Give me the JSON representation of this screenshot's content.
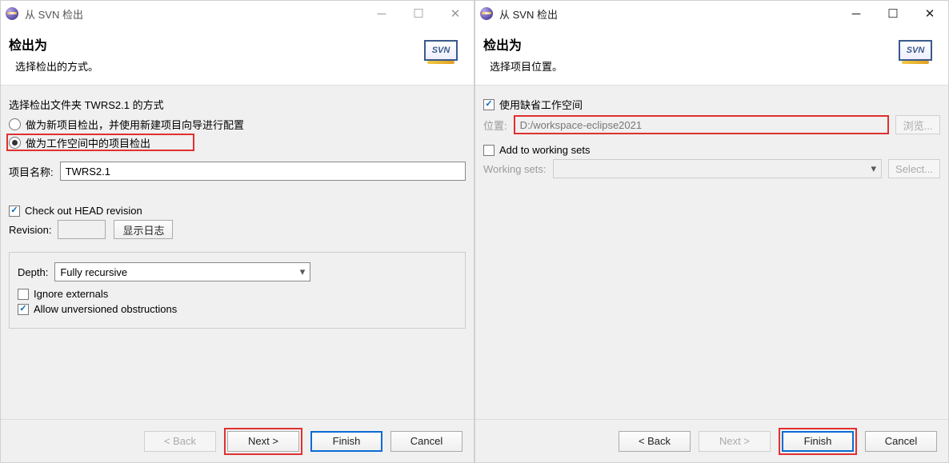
{
  "left": {
    "title": "从 SVN 检出",
    "header_title": "检出为",
    "header_subtitle": "选择检出的方式。",
    "svn_label": "SVN",
    "option_intro": "选择检出文件夹 TWRS2.1 的方式",
    "radio_new_project": "做为新项目检出，并使用新建项目向导进行配置",
    "radio_workspace": "做为工作空间中的项目检出",
    "project_name_label": "项目名称:",
    "project_name_value": "TWRS2.1",
    "check_head": "Check out HEAD revision",
    "revision_label": "Revision:",
    "revision_value": "",
    "show_log": "显示日志",
    "depth_label": "Depth:",
    "depth_value": "Fully recursive",
    "ignore_externals": "Ignore externals",
    "allow_unversioned": "Allow unversioned obstructions",
    "back": "< Back",
    "next": "Next >",
    "finish": "Finish",
    "cancel": "Cancel"
  },
  "right": {
    "title": "从 SVN 检出",
    "header_title": "检出为",
    "header_subtitle": "选择项目位置。",
    "svn_label": "SVN",
    "use_default_ws": "使用缺省工作空间",
    "location_label": "位置:",
    "location_value": "D:/workspace-eclipse2021",
    "browse": "浏览...",
    "add_working_sets": "Add to working sets",
    "working_sets_label": "Working sets:",
    "select": "Select...",
    "back": "< Back",
    "next": "Next >",
    "finish": "Finish",
    "cancel": "Cancel"
  }
}
